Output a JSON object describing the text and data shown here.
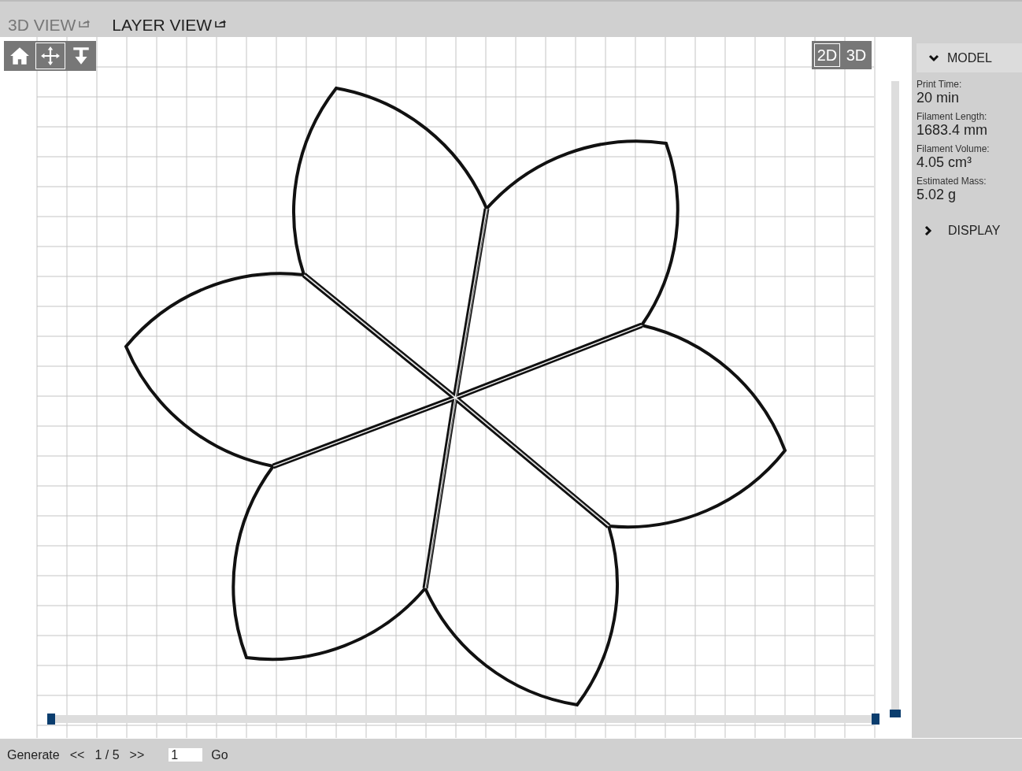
{
  "tabs": [
    {
      "label": "3D VIEW",
      "selected": false
    },
    {
      "label": "LAYER VIEW",
      "selected": true
    }
  ],
  "view_tools": [
    {
      "kind": "home",
      "selected": false
    },
    {
      "kind": "move",
      "selected": true
    },
    {
      "kind": "lower",
      "selected": false
    }
  ],
  "view_modes": [
    {
      "label": "2D",
      "selected": true
    },
    {
      "label": "3D",
      "selected": false
    }
  ],
  "layer_slider": {
    "start": {
      "level": 0
    },
    "end": {
      "level": 1
    }
  },
  "height_slider": {
    "level": 0
  },
  "sidebar": {
    "sections": [
      {
        "title": "MODEL",
        "expanded": true,
        "stats": [
          {
            "label": "Print Time:",
            "value": "20 min"
          },
          {
            "label": "Filament Length:",
            "value": "1683.4 mm"
          },
          {
            "label": "Filament Volume:",
            "value": "4.05 cm³"
          },
          {
            "label": "Estimated Mass:",
            "value": "5.02 g"
          }
        ]
      },
      {
        "title": "DISPLAY",
        "expanded": false
      }
    ]
  },
  "bottom_bar": {
    "generate": "Generate",
    "prev": "<<",
    "page": "1 / 5",
    "next": ">>",
    "page_input": "1",
    "go": "Go"
  }
}
